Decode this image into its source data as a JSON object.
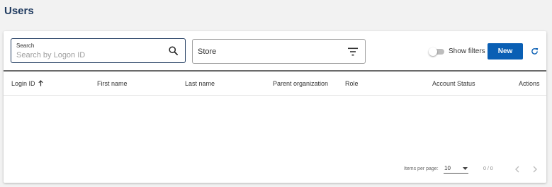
{
  "page": {
    "title": "Users"
  },
  "search": {
    "label": "Search",
    "placeholder": "Search by Logon ID",
    "value": ""
  },
  "store_filter": {
    "label": "Store"
  },
  "filters_toggle": {
    "label": "Show filters",
    "on": false
  },
  "toolbar": {
    "new_label": "New"
  },
  "table": {
    "columns": [
      {
        "label": "Login ID",
        "sort": "ascending"
      },
      {
        "label": "First name"
      },
      {
        "label": "Last name"
      },
      {
        "label": "Parent organization"
      },
      {
        "label": "Role"
      },
      {
        "label": "Account Status"
      },
      {
        "label": "Actions"
      }
    ],
    "rows": []
  },
  "paginator": {
    "items_per_page_label": "Items per page:",
    "page_size": "10",
    "range": "0 / 0"
  },
  "colors": {
    "accent": "#0a5fb4",
    "title": "#1f3a5f",
    "background": "#f2f2f2"
  }
}
